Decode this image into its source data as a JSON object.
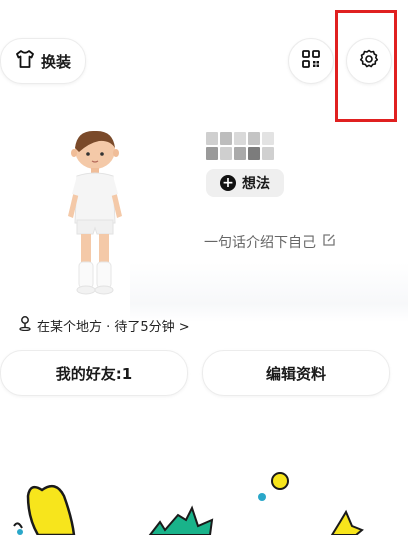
{
  "header": {
    "outfit_label": "换装",
    "qr_icon": "qr-code-icon",
    "settings_icon": "gear-icon"
  },
  "profile": {
    "thought_label": "想法",
    "bio": "一句话介绍下自己",
    "location": "在某个地方 · 待了5分钟 >"
  },
  "actions": {
    "friends_label": "我的好友:1",
    "edit_label": "编辑资料"
  },
  "colors": {
    "highlight": "#e02020",
    "deco_yellow": "#f7e51c",
    "deco_green": "#19b38a",
    "deco_blue": "#2aa7c9"
  }
}
